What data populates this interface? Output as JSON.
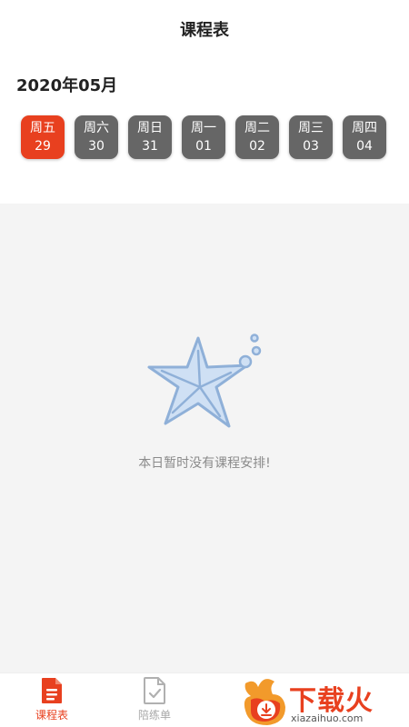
{
  "header": {
    "title": "课程表"
  },
  "calendar": {
    "month_label": "2020年05月",
    "days": [
      {
        "weekday": "周五",
        "date": "29",
        "selected": true
      },
      {
        "weekday": "周六",
        "date": "30",
        "selected": false
      },
      {
        "weekday": "周日",
        "date": "31",
        "selected": false
      },
      {
        "weekday": "周一",
        "date": "01",
        "selected": false
      },
      {
        "weekday": "周二",
        "date": "02",
        "selected": false
      },
      {
        "weekday": "周三",
        "date": "03",
        "selected": false
      },
      {
        "weekday": "周四",
        "date": "04",
        "selected": false
      }
    ]
  },
  "empty_state": {
    "icon": "starfish-icon",
    "message": "本日暂时没有课程安排!"
  },
  "tabbar": {
    "items": [
      {
        "label": "课程表",
        "icon": "document-icon",
        "active": true
      },
      {
        "label": "陪练单",
        "icon": "checklist-icon",
        "active": false
      }
    ]
  },
  "watermark": {
    "text": "下载火",
    "subtext": "xiazaihuo.com"
  },
  "colors": {
    "accent": "#e8401f",
    "day_inactive": "#666666",
    "content_bg": "#f4f4f4",
    "icon_blue": "#8fb0d8"
  }
}
